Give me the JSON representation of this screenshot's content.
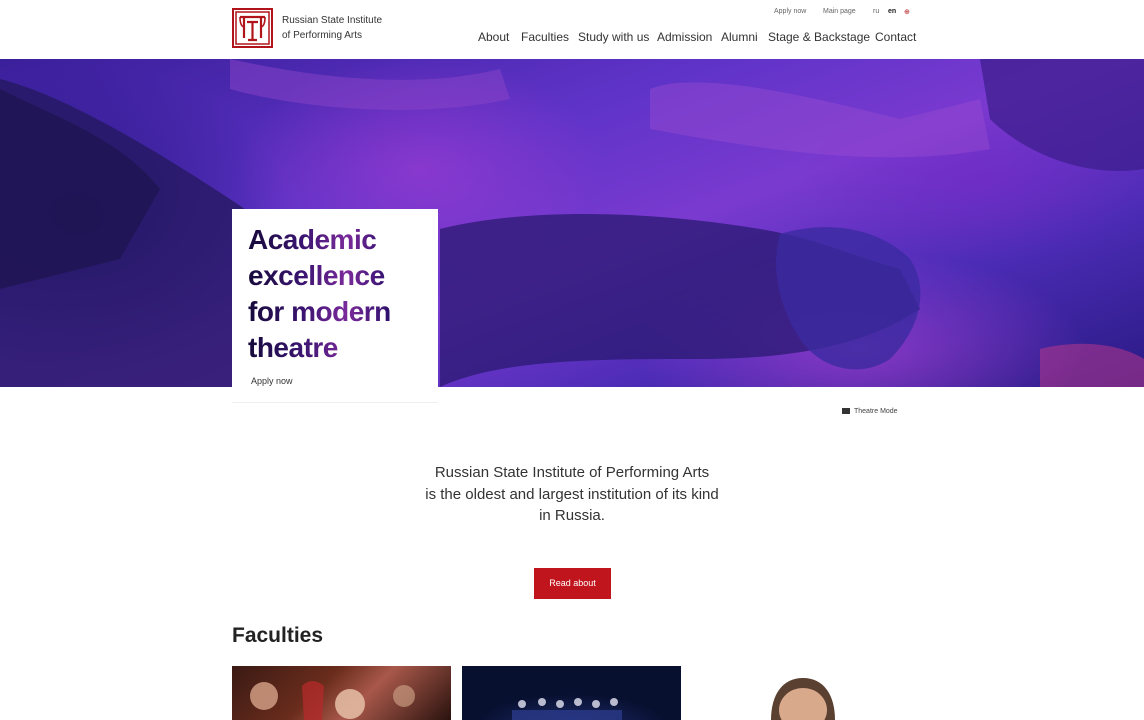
{
  "brand": {
    "line1": "Russian State Institute",
    "line2": "of Performing Arts"
  },
  "util_nav": {
    "apply": "Apply now",
    "main": "Main page",
    "ru": "ru",
    "en": "en",
    "flag": "⊕"
  },
  "nav": [
    "About",
    "Faculties",
    "Study with us",
    "Admission",
    "Alumni",
    "Stage & Backstage",
    "Contact"
  ],
  "hero": {
    "title_lines": [
      "Academic",
      "excellence",
      "for modern",
      "theatre"
    ],
    "apply": "Apply now"
  },
  "theatre_mode": "Theatre Mode",
  "intro_lines": [
    "Russian State Institute of Performing Arts",
    "is the oldest and largest institution of its kind",
    "in Russia."
  ],
  "read_button": "Read about",
  "faculties_title": "Faculties",
  "colors": {
    "accent": "#c0151c",
    "hero_base": "#5f33c8"
  }
}
